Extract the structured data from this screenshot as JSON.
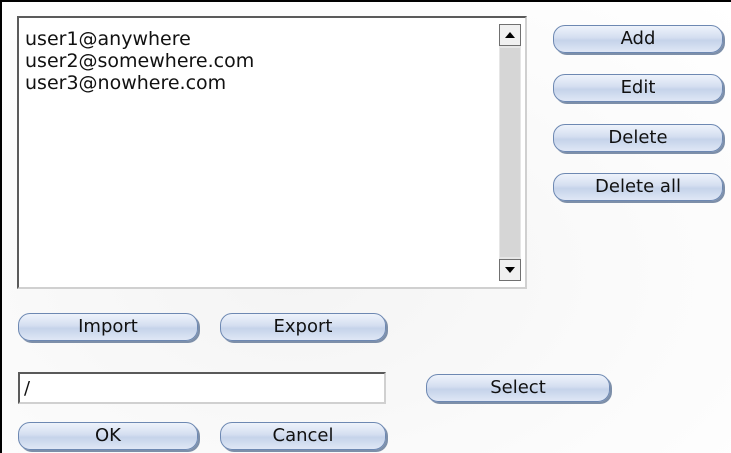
{
  "list": {
    "items": [
      "user1@anywhere",
      "user2@somewhere.com",
      "user3@nowhere.com"
    ]
  },
  "buttons": {
    "add": "Add",
    "edit": "Edit",
    "delete": "Delete",
    "delete_all": "Delete all",
    "import": "Import",
    "export": "Export",
    "select": "Select",
    "ok": "OK",
    "cancel": "Cancel"
  },
  "path_field": {
    "value": "/"
  },
  "icons": {
    "scroll_up": "arrow-up-icon",
    "scroll_down": "arrow-down-icon"
  }
}
